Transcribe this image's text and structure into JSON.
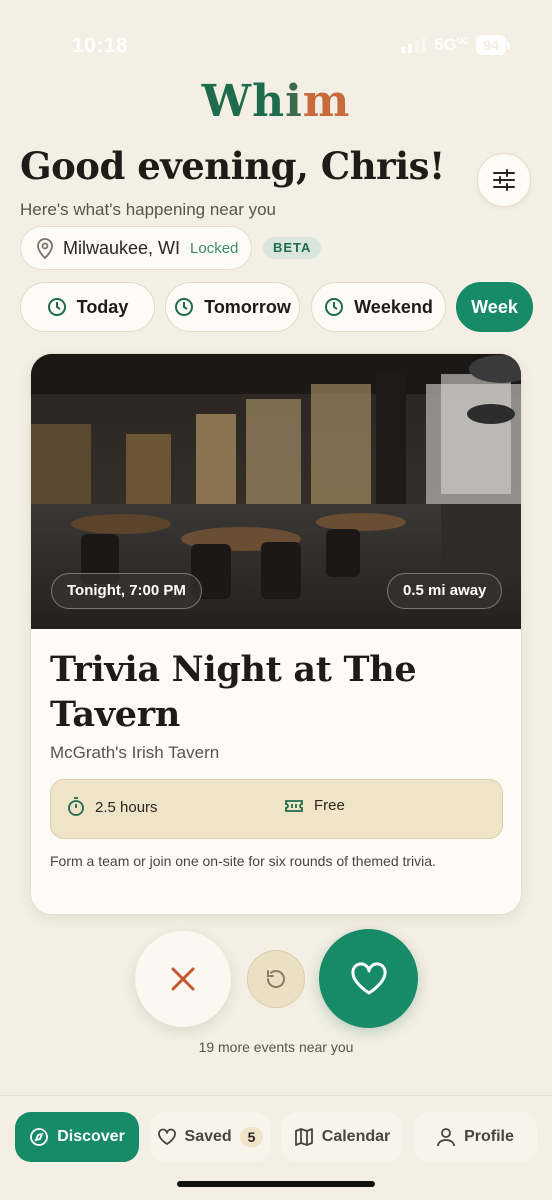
{
  "status_bar": {
    "time": "10:18",
    "network": "5G",
    "network_superscript": "UC",
    "battery": "94"
  },
  "app": {
    "logo_parts": [
      "Wh",
      "i",
      "m"
    ]
  },
  "header": {
    "greeting": "Good evening, Chris!",
    "subtitle": "Here's what's happening near you",
    "location": "Milwaukee, WI",
    "location_status": "Locked",
    "beta_label": "BETA"
  },
  "time_filters": [
    {
      "label": "Today",
      "active": false
    },
    {
      "label": "Tomorrow",
      "active": false
    },
    {
      "label": "Weekend",
      "active": false
    },
    {
      "label": "Week",
      "active": true
    }
  ],
  "event": {
    "time_badge": "Tonight, 7:00 PM",
    "distance_badge": "0.5 mi away",
    "title": "Trivia Night at The Tavern",
    "venue": "McGrath's Irish Tavern",
    "duration": "2.5 hours",
    "price": "Free",
    "description": "Form a team or join one on-site for six rounds of themed trivia."
  },
  "more_events": "19 more events near you",
  "tabs": [
    {
      "label": "Discover",
      "icon": "compass-icon",
      "active": true
    },
    {
      "label": "Saved",
      "icon": "heart-icon",
      "count": "5",
      "active": false
    },
    {
      "label": "Calendar",
      "icon": "map-icon",
      "active": false
    },
    {
      "label": "Profile",
      "icon": "person-icon",
      "active": false
    }
  ],
  "colors": {
    "background": "#f4efe4",
    "accent": "#178a68",
    "logo_green": "#1f6b4e",
    "logo_orange": "#c86b3c",
    "pass": "#c4572f"
  }
}
